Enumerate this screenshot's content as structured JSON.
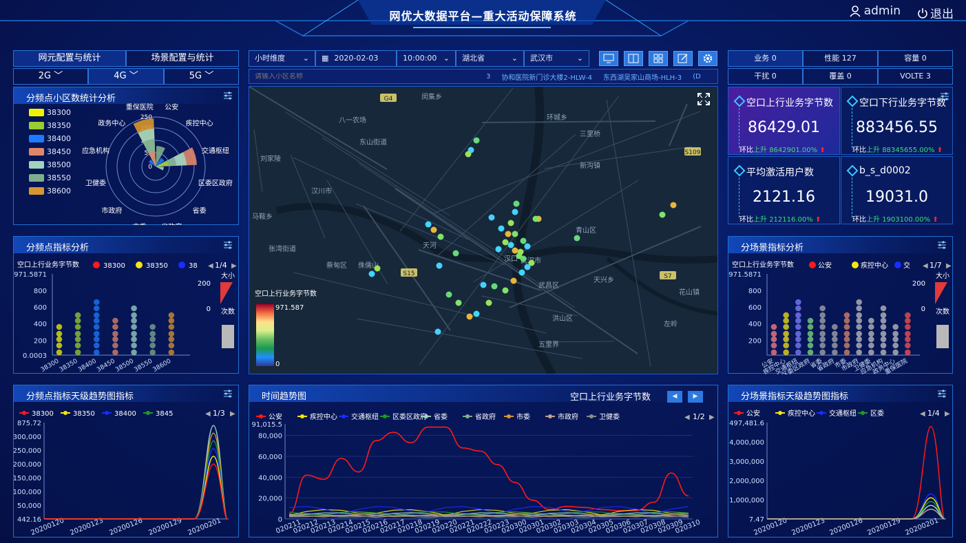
{
  "header": {
    "title": "网优大数据平台—重大活动保障系统",
    "user": "admin",
    "logout": "退出"
  },
  "left_tabs": [
    "网元配置与统计",
    "场景配置与统计"
  ],
  "net_tabs": [
    "2G",
    "4G",
    "5G"
  ],
  "filters": {
    "dimension": "小时维度",
    "date": "2020-02-03",
    "time": "10:00:00",
    "province": "湖北省",
    "city": "武汉市",
    "search_placeholder": "请输入小区名称"
  },
  "ticker": [
    "3",
    "协和医院新门诊大楼2-HLW-4",
    "东西湖吴家山商场-HLH-3",
    "(D"
  ],
  "kpi_tabs": [
    [
      "业务 0",
      "性能 127",
      "容量 0"
    ],
    [
      "干扰 0",
      "覆盖 0",
      "VOLTE 3"
    ]
  ],
  "kpis": [
    {
      "label": "空口上行业务字节数",
      "value": "86429.01",
      "ratio_prefix": "环比",
      "ratio_word": "上升",
      "ratio_value": "8642901.00%"
    },
    {
      "label": "空口下行业务字节数",
      "value": "883456.55",
      "ratio_prefix": "环比",
      "ratio_word": "上升",
      "ratio_value": "88345655.00%"
    },
    {
      "label": "平均激活用户数",
      "value": "2121.16",
      "ratio_prefix": "环比",
      "ratio_word": "上升",
      "ratio_value": "212116.00%"
    },
    {
      "label": "b_s_d0002",
      "value": "19031.0",
      "ratio_prefix": "环比",
      "ratio_word": "上升",
      "ratio_value": "1903100.00%"
    }
  ],
  "panel_titles": {
    "p1": "分频点小区数统计分析",
    "p2": "分频点指标分析",
    "p3": "分频点指标天级趋势图指标",
    "p4": "分场景指标分析",
    "p5": "分场景指标天级趋势图指标",
    "p6": "时间趋势图",
    "p6_metric": "空口上行业务字节数"
  },
  "freq_legend": [
    {
      "name": "38300",
      "color": "#f2f200"
    },
    {
      "name": "38350",
      "color": "#9acd32"
    },
    {
      "name": "38400",
      "color": "#1e7bff"
    },
    {
      "name": "38450",
      "color": "#e0876a"
    },
    {
      "name": "38500",
      "color": "#9fd4c0"
    },
    {
      "name": "38550",
      "color": "#7fae8f"
    },
    {
      "name": "38600",
      "color": "#d8962e"
    }
  ],
  "polar": {
    "categories": [
      "公安",
      "疾控中心",
      "交通枢纽",
      "区委区政府",
      "省委",
      "省政府",
      "市委",
      "市政府",
      "卫健委",
      "应急机构",
      "政务中心",
      "重保医院"
    ],
    "ticks": [
      "0",
      "50",
      "100",
      "150",
      "250"
    ]
  },
  "scatter_left": {
    "metric": "空口上行业务字节数",
    "legend": [
      "38300",
      "38350",
      "38"
    ],
    "pager": "1/4",
    "ymax": "971.5871",
    "ymin": "0.0003",
    "yticks": [
      "800",
      "600",
      "400",
      "200"
    ],
    "xcats": [
      "38300",
      "38350",
      "38400",
      "38450",
      "38500",
      "38550",
      "38600"
    ],
    "size_label": "大小",
    "size_hi": "200",
    "size_lo": "0",
    "count_label": "次数"
  },
  "scatter_right": {
    "metric": "空口上行业务字节数",
    "legend": [
      "公安",
      "疾控中心",
      "交"
    ],
    "pager": "1/7",
    "ymax": "971.5871",
    "yticks": [
      "800",
      "600",
      "400",
      "200"
    ],
    "xcats": [
      "公安",
      "疾控中心",
      "交通枢纽",
      "区委区政府",
      "省委",
      "省政府",
      "市委",
      "市政府",
      "卫健委",
      "应急机构",
      "政务中心",
      "重保医院"
    ],
    "size_label": "大小",
    "size_hi": "200",
    "size_lo": "0",
    "count_label": "次数"
  },
  "trend_left": {
    "legend": [
      "38300",
      "38350",
      "38400",
      "3845"
    ],
    "pager": "1/3",
    "yticks": [
      "875.72",
      "300,000",
      "250,000",
      "200,000",
      "150,000",
      "100,000",
      "50,000",
      "442.16"
    ],
    "xticks": [
      "20200120",
      "20200123",
      "20200126",
      "20200129",
      "20200201"
    ]
  },
  "trend_right": {
    "legend": [
      "公安",
      "疾控中心",
      "交通枢纽",
      "区委"
    ],
    "pager": "1/4",
    "yticks": [
      "497,481.6",
      "4,000,000",
      "3,000,000",
      "2,000,000",
      "1,000,000",
      "7.47"
    ],
    "xticks": [
      "20200120",
      "20200123",
      "20200126",
      "20200129",
      "20200201"
    ]
  },
  "time_trend": {
    "legend": [
      {
        "name": "公安",
        "color": "#ff1a1a"
      },
      {
        "name": "疾控中心",
        "color": "#f5e612"
      },
      {
        "name": "交通枢纽",
        "color": "#1a2cff"
      },
      {
        "name": "区委区政府",
        "color": "#1a9a2a"
      },
      {
        "name": "省委",
        "color": "#9fd4c0"
      },
      {
        "name": "省政府",
        "color": "#7fae8f"
      },
      {
        "name": "市委",
        "color": "#d8962e"
      },
      {
        "name": "市政府",
        "color": "#c0a090"
      },
      {
        "name": "卫健委",
        "color": "#8c8c8c"
      }
    ],
    "pager": "1/2",
    "ymax_label": "91,015.5",
    "yticks": [
      "80,000",
      "60,000",
      "40,000",
      "20,000",
      "0"
    ],
    "xticks": [
      "020211",
      "020212",
      "020213",
      "020214",
      "020215",
      "020216",
      "020217",
      "020218",
      "020219",
      "020220",
      "020221",
      "020222",
      "020223",
      "020300",
      "020301",
      "020302",
      "020303",
      "020304",
      "020305",
      "020306",
      "020307",
      "020308",
      "020309",
      "020310"
    ]
  },
  "chart_data": {
    "type": "line",
    "title": "时间趋势图",
    "x": [
      "020211",
      "020212",
      "020213",
      "020214",
      "020215",
      "020216",
      "020217",
      "020218",
      "020219",
      "020220",
      "020221",
      "020222",
      "020223",
      "020300",
      "020301",
      "020302",
      "020303",
      "020304",
      "020305",
      "020306",
      "020307",
      "020308",
      "020309",
      "020310"
    ],
    "ylim": [
      0,
      91015.5
    ],
    "series": [
      {
        "name": "公安",
        "values": [
          5000,
          42000,
          38000,
          58000,
          45000,
          75000,
          83000,
          73000,
          88000,
          88000,
          68000,
          65000,
          52000,
          35000,
          18000,
          9000,
          12000,
          11000,
          9000,
          8000,
          8000,
          16000,
          44000,
          22000
        ]
      }
    ]
  },
  "map": {
    "colorbar_title": "空口上行业务字节数",
    "cb_max": "971.587",
    "cb_min": "0",
    "places": [
      "闵集乡",
      "八一农场",
      "东山街道",
      "环城乡",
      "三里桥",
      "刘家陵",
      "新沟镇",
      "汉川市",
      "马鞍乡",
      "张湾街道",
      "蔡甸区",
      "侏儒山",
      "天河",
      "汉口",
      "武汉市",
      "武昌区",
      "青山区",
      "洪山区",
      "花山镇",
      "左岭",
      "天兴乡",
      "五里界"
    ],
    "roads": [
      "G4",
      "S109",
      "S15",
      "S7"
    ]
  }
}
